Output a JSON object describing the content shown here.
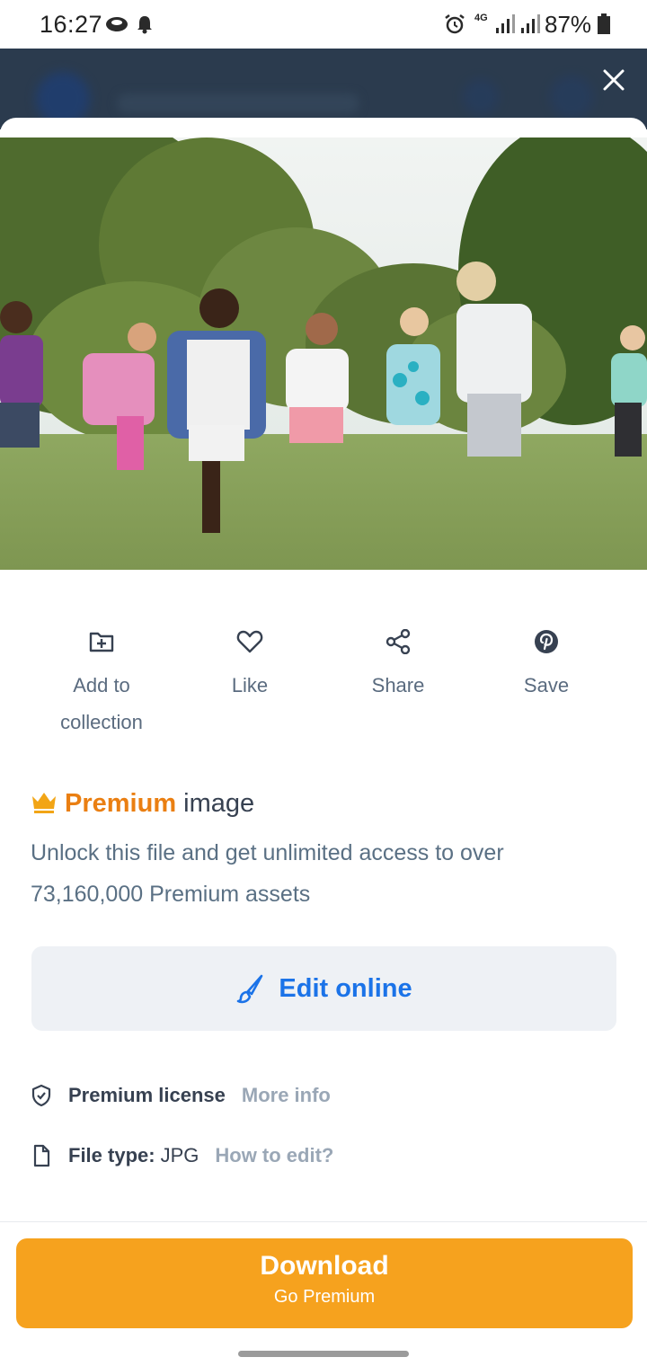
{
  "status_bar": {
    "time": "16:27",
    "network": "4G",
    "battery": "87%"
  },
  "actions": [
    {
      "label": "Add to collection",
      "icon": "folder-plus-icon"
    },
    {
      "label": "Like",
      "icon": "heart-icon"
    },
    {
      "label": "Share",
      "icon": "share-icon"
    },
    {
      "label": "Save",
      "icon": "pinterest-icon"
    }
  ],
  "premium": {
    "highlight": "Premium",
    "rest": "image",
    "description": "Unlock this file and get unlimited access to over 73,160,000 Premium assets",
    "accent_color": "#ea7f12"
  },
  "edit_button": {
    "label": "Edit online",
    "color": "#1b73e8"
  },
  "license": {
    "label": "Premium license",
    "link": "More info"
  },
  "file_type": {
    "label": "File type:",
    "value": "JPG",
    "link": "How to edit?"
  },
  "download_button": {
    "title": "Download",
    "subtitle": "Go Premium",
    "color": "#f6a21e"
  }
}
